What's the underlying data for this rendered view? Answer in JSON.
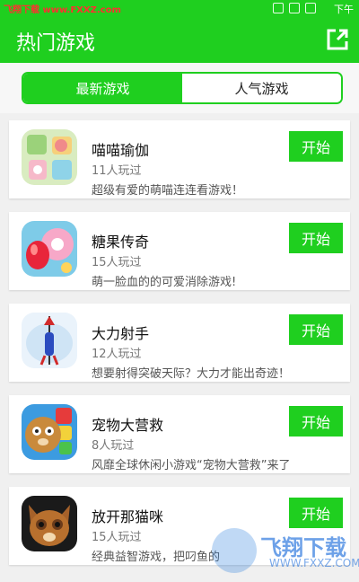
{
  "statusbar": {
    "watermark": "飞翔下载 www.FXXZ.com",
    "time": "下午"
  },
  "appbar": {
    "title": "热门游戏"
  },
  "tabs": [
    {
      "label": "最新游戏",
      "active": true
    },
    {
      "label": "人气游戏",
      "active": false
    }
  ],
  "games": [
    {
      "name": "喵喵瑜伽",
      "players": "11人玩过",
      "desc": "超级有爱的萌喵连连看游戏！",
      "button": "开始",
      "icon": "cat-yoga-icon"
    },
    {
      "name": "糖果传奇",
      "players": "15人玩过",
      "desc": "萌一脸血的的可爱消除游戏!",
      "button": "开始",
      "icon": "candy-icon"
    },
    {
      "name": "大力射手",
      "players": "12人玩过",
      "desc": "想要射得突破天际？大力才能出奇迹！",
      "button": "开始",
      "icon": "arrow-shooter-icon"
    },
    {
      "name": "宠物大营救",
      "players": "8人玩过",
      "desc": "风靡全球休闲小游戏“宠物大营救”来了",
      "button": "开始",
      "icon": "pet-rescue-icon"
    },
    {
      "name": "放开那猫咪",
      "players": "15人玩过",
      "desc": "经典益智游戏，把叼鱼的",
      "button": "开始",
      "icon": "puss-cat-icon"
    }
  ],
  "watermark": {
    "brand": "飞翔下载",
    "url": "WWW.FXXZ.COM"
  },
  "colors": {
    "primary": "#1fcf1f",
    "background": "#f0f0f0",
    "card": "#ffffff"
  }
}
